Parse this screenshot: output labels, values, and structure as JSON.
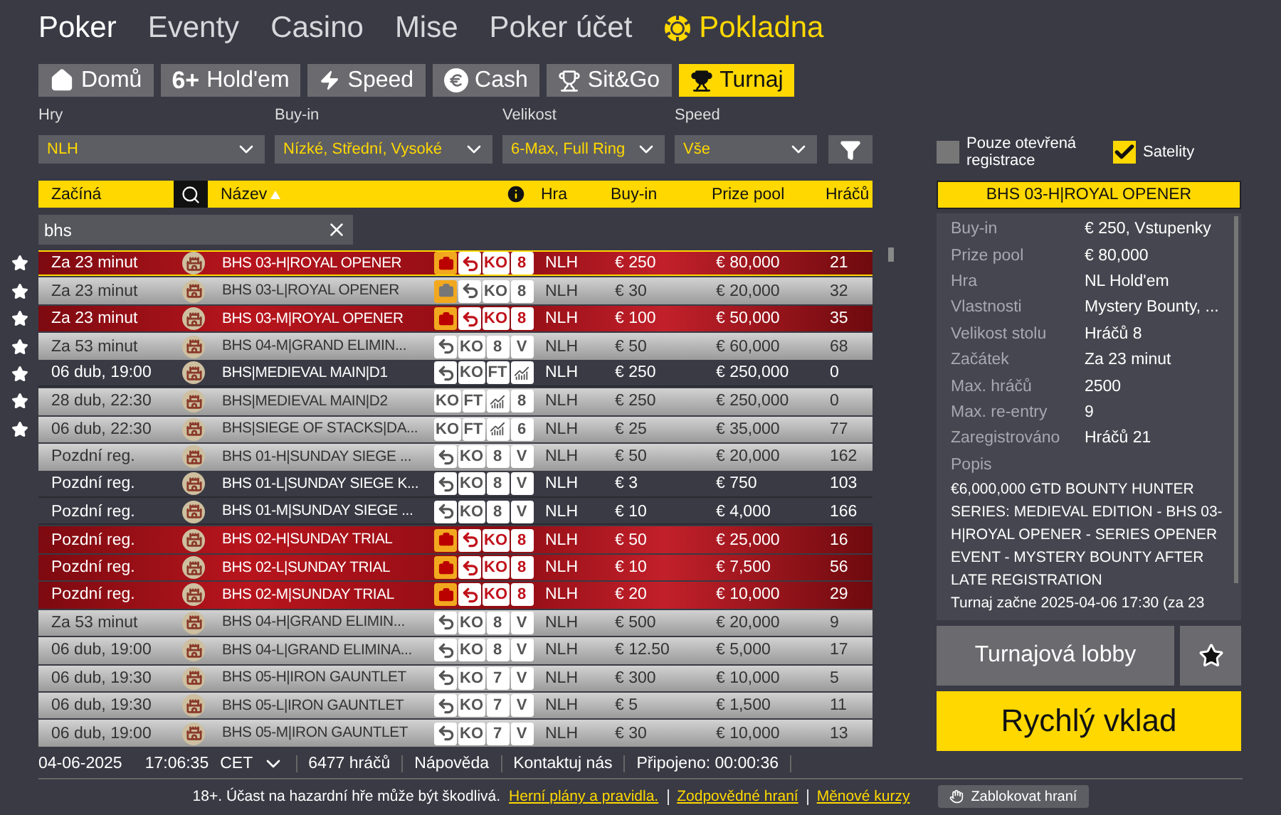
{
  "nav": [
    {
      "label": "Poker",
      "selected": true,
      "kind": "text"
    },
    {
      "label": "Eventy",
      "selected": false,
      "kind": "text"
    },
    {
      "label": "Casino",
      "selected": false,
      "kind": "text"
    },
    {
      "label": "Mise",
      "selected": false,
      "kind": "text"
    },
    {
      "label": "Poker účet",
      "selected": false,
      "kind": "text"
    },
    {
      "label": "Pokladna",
      "selected": false,
      "kind": "cashier"
    }
  ],
  "tabs": [
    {
      "label": "Domů",
      "kind": "home",
      "selected": false
    },
    {
      "label": "Hold'em",
      "kind": "text",
      "icon_text": "6+",
      "selected": false
    },
    {
      "label": "Speed",
      "kind": "bolt",
      "selected": false
    },
    {
      "label": "Cash",
      "kind": "euro",
      "selected": false
    },
    {
      "label": "Sit&Go",
      "kind": "trophy",
      "selected": false
    },
    {
      "label": "Turnaj",
      "kind": "cup",
      "selected": true
    }
  ],
  "filters": [
    {
      "label": "Hry",
      "value": "NLH"
    },
    {
      "label": "Buy-in",
      "value": "Nízké, Střední, Vysoké"
    },
    {
      "label": "Velikost",
      "value": "6-Max, Full Ring"
    },
    {
      "label": "Speed",
      "value": "Vše"
    }
  ],
  "checkboxes": [
    {
      "label": "Pouze otevřená registrace",
      "checked": false
    },
    {
      "label": "Satelity",
      "checked": true
    }
  ],
  "table": {
    "columns": [
      "Začíná",
      "Název",
      "Hra",
      "Buy-in",
      "Prize pool",
      "Hráčů"
    ],
    "search": {
      "value": "bhs"
    },
    "rows": [
      {
        "starts": "Za 23 minut",
        "name": "BHS 03-H|ROYAL OPENER",
        "badges": [
          {
            "kind": "bag"
          },
          {
            "kind": "reentry"
          },
          {
            "kind": "text",
            "text": "KO"
          },
          {
            "kind": "text",
            "text": "8"
          }
        ],
        "game": "NLH",
        "buyin": "€ 250",
        "prize": "€ 80,000",
        "players": "21",
        "kind": "red",
        "selected": true,
        "favorite": true
      },
      {
        "starts": "Za 23 minut",
        "name": "BHS 03-L|ROYAL OPENER",
        "badges": [
          {
            "kind": "bag"
          },
          {
            "kind": "reentry"
          },
          {
            "kind": "text",
            "text": "KO"
          },
          {
            "kind": "text",
            "text": "8"
          }
        ],
        "game": "NLH",
        "buyin": "€ 30",
        "prize": "€ 20,000",
        "players": "32",
        "kind": "grey",
        "selected": false,
        "favorite": true
      },
      {
        "starts": "Za 23 minut",
        "name": "BHS 03-M|ROYAL OPENER",
        "badges": [
          {
            "kind": "bag"
          },
          {
            "kind": "reentry"
          },
          {
            "kind": "text",
            "text": "KO"
          },
          {
            "kind": "text",
            "text": "8"
          }
        ],
        "game": "NLH",
        "buyin": "€ 100",
        "prize": "€ 50,000",
        "players": "35",
        "kind": "red",
        "selected": false,
        "favorite": true
      },
      {
        "starts": "Za 53 minut",
        "name": "BHS 04-M|GRAND ELIMIN...",
        "badges": [
          {
            "kind": "reentry"
          },
          {
            "kind": "text",
            "text": "KO"
          },
          {
            "kind": "text",
            "text": "8"
          },
          {
            "kind": "text",
            "text": "V"
          }
        ],
        "game": "NLH",
        "buyin": "€ 50",
        "prize": "€ 60,000",
        "players": "68",
        "kind": "grey",
        "selected": false,
        "favorite": true
      },
      {
        "starts": "06 dub, 19:00",
        "name": "BHS|MEDIEVAL MAIN|D1",
        "badges": [
          {
            "kind": "reentry"
          },
          {
            "kind": "text",
            "text": "KO"
          },
          {
            "kind": "text",
            "text": "FT"
          },
          {
            "kind": "chart"
          }
        ],
        "game": "NLH",
        "buyin": "€ 250",
        "prize": "€ 250,000",
        "players": "0",
        "kind": "plain",
        "selected": false,
        "favorite": true
      },
      {
        "starts": "28 dub, 22:30",
        "name": "BHS|MEDIEVAL MAIN|D2",
        "badges": [
          {
            "kind": "text",
            "text": "KO"
          },
          {
            "kind": "text",
            "text": "FT"
          },
          {
            "kind": "chart"
          },
          {
            "kind": "text",
            "text": "8"
          }
        ],
        "game": "NLH",
        "buyin": "€ 250",
        "prize": "€ 250,000",
        "players": "0",
        "kind": "grey",
        "selected": false,
        "favorite": true
      },
      {
        "starts": "06 dub, 22:30",
        "name": "BHS|SIEGE OF STACKS|DA...",
        "badges": [
          {
            "kind": "text",
            "text": "KO"
          },
          {
            "kind": "text",
            "text": "FT"
          },
          {
            "kind": "chart"
          },
          {
            "kind": "text",
            "text": "6"
          }
        ],
        "game": "NLH",
        "buyin": "€ 25",
        "prize": "€ 35,000",
        "players": "77",
        "kind": "grey",
        "selected": false,
        "favorite": true
      },
      {
        "starts": "Pozdní reg.",
        "name": "BHS 01-H|SUNDAY SIEGE ...",
        "badges": [
          {
            "kind": "reentry"
          },
          {
            "kind": "text",
            "text": "KO"
          },
          {
            "kind": "text",
            "text": "8"
          },
          {
            "kind": "text",
            "text": "V"
          }
        ],
        "game": "NLH",
        "buyin": "€ 50",
        "prize": "€ 20,000",
        "players": "162",
        "kind": "grey",
        "selected": false,
        "favorite": false
      },
      {
        "starts": "Pozdní reg.",
        "name": "BHS 01-L|SUNDAY SIEGE K...",
        "badges": [
          {
            "kind": "reentry"
          },
          {
            "kind": "text",
            "text": "KO"
          },
          {
            "kind": "text",
            "text": "8"
          },
          {
            "kind": "text",
            "text": "V"
          }
        ],
        "game": "NLH",
        "buyin": "€ 3",
        "prize": "€ 750",
        "players": "103",
        "kind": "plain",
        "selected": false,
        "favorite": false
      },
      {
        "starts": "Pozdní reg.",
        "name": "BHS 01-M|SUNDAY SIEGE ...",
        "badges": [
          {
            "kind": "reentry"
          },
          {
            "kind": "text",
            "text": "KO"
          },
          {
            "kind": "text",
            "text": "8"
          },
          {
            "kind": "text",
            "text": "V"
          }
        ],
        "game": "NLH",
        "buyin": "€ 10",
        "prize": "€ 4,000",
        "players": "166",
        "kind": "plain",
        "selected": false,
        "favorite": false
      },
      {
        "starts": "Pozdní reg.",
        "name": "BHS 02-H|SUNDAY TRIAL",
        "badges": [
          {
            "kind": "bag"
          },
          {
            "kind": "reentry"
          },
          {
            "kind": "text",
            "text": "KO"
          },
          {
            "kind": "text",
            "text": "8"
          }
        ],
        "game": "NLH",
        "buyin": "€ 50",
        "prize": "€ 25,000",
        "players": "16",
        "kind": "red",
        "selected": false,
        "favorite": false
      },
      {
        "starts": "Pozdní reg.",
        "name": "BHS 02-L|SUNDAY TRIAL",
        "badges": [
          {
            "kind": "bag"
          },
          {
            "kind": "reentry"
          },
          {
            "kind": "text",
            "text": "KO"
          },
          {
            "kind": "text",
            "text": "8"
          }
        ],
        "game": "NLH",
        "buyin": "€ 10",
        "prize": "€ 7,500",
        "players": "56",
        "kind": "red",
        "selected": false,
        "favorite": false
      },
      {
        "starts": "Pozdní reg.",
        "name": "BHS 02-M|SUNDAY TRIAL",
        "badges": [
          {
            "kind": "bag"
          },
          {
            "kind": "reentry"
          },
          {
            "kind": "text",
            "text": "KO"
          },
          {
            "kind": "text",
            "text": "8"
          }
        ],
        "game": "NLH",
        "buyin": "€ 20",
        "prize": "€ 10,000",
        "players": "29",
        "kind": "red",
        "selected": false,
        "favorite": false
      },
      {
        "starts": "Za 53 minut",
        "name": "BHS 04-H|GRAND ELIMIN...",
        "badges": [
          {
            "kind": "reentry"
          },
          {
            "kind": "text",
            "text": "KO"
          },
          {
            "kind": "text",
            "text": "8"
          },
          {
            "kind": "text",
            "text": "V"
          }
        ],
        "game": "NLH",
        "buyin": "€ 500",
        "prize": "€ 20,000",
        "players": "9",
        "kind": "grey",
        "selected": false,
        "favorite": false
      },
      {
        "starts": "06 dub, 19:00",
        "name": "BHS 04-L|GRAND ELIMINA...",
        "badges": [
          {
            "kind": "reentry"
          },
          {
            "kind": "text",
            "text": "KO"
          },
          {
            "kind": "text",
            "text": "8"
          },
          {
            "kind": "text",
            "text": "V"
          }
        ],
        "game": "NLH",
        "buyin": "€ 12.50",
        "prize": "€ 5,000",
        "players": "17",
        "kind": "grey",
        "selected": false,
        "favorite": false
      },
      {
        "starts": "06 dub, 19:30",
        "name": "BHS 05-H|IRON GAUNTLET",
        "badges": [
          {
            "kind": "reentry"
          },
          {
            "kind": "text",
            "text": "KO"
          },
          {
            "kind": "text",
            "text": "7"
          },
          {
            "kind": "text",
            "text": "V"
          }
        ],
        "game": "NLH",
        "buyin": "€ 300",
        "prize": "€ 10,000",
        "players": "5",
        "kind": "grey",
        "selected": false,
        "favorite": false
      },
      {
        "starts": "06 dub, 19:30",
        "name": "BHS 05-L|IRON GAUNTLET",
        "badges": [
          {
            "kind": "reentry"
          },
          {
            "kind": "text",
            "text": "KO"
          },
          {
            "kind": "text",
            "text": "7"
          },
          {
            "kind": "text",
            "text": "V"
          }
        ],
        "game": "NLH",
        "buyin": "€ 5",
        "prize": "€ 1,500",
        "players": "11",
        "kind": "grey",
        "selected": false,
        "favorite": false
      },
      {
        "starts": "06 dub, 19:00",
        "name": "BHS 05-M|IRON GAUNTLET",
        "badges": [
          {
            "kind": "reentry"
          },
          {
            "kind": "text",
            "text": "KO"
          },
          {
            "kind": "text",
            "text": "7"
          },
          {
            "kind": "text",
            "text": "V"
          }
        ],
        "game": "NLH",
        "buyin": "€ 30",
        "prize": "€ 10,000",
        "players": "13",
        "kind": "grey",
        "selected": false,
        "favorite": false
      }
    ]
  },
  "details": {
    "title": "BHS 03-H|ROYAL OPENER",
    "fields": [
      {
        "label": "Buy-in",
        "value": "€ 250, Vstupenky"
      },
      {
        "label": "Prize pool",
        "value": "€ 80,000"
      },
      {
        "label": "Hra",
        "value": "NL Hold'em"
      },
      {
        "label": "Vlastnosti",
        "value": "Mystery Bounty, ..."
      },
      {
        "label": "Velikost stolu",
        "value": "Hráčů 8"
      },
      {
        "label": "Začátek",
        "value": "Za 23 minut"
      },
      {
        "label": "Max. hráčů",
        "value": "2500"
      },
      {
        "label": "Max. re-entry",
        "value": "9"
      },
      {
        "label": "Zaregistrováno",
        "value": "Hráčů 21"
      }
    ],
    "description_label": "Popis",
    "description": "€6,000,000 GTD BOUNTY HUNTER SERIES: MEDIEVAL EDITION - BHS 03-H|ROYAL OPENER - SERIES OPENER EVENT - MYSTERY BOUNTY AFTER LATE REGISTRATION",
    "description_more": "Turnaj začne 2025-04-06 17:30 (za 23",
    "lobby_button": "Turnajová lobby",
    "deposit_button": "Rychlý vklad"
  },
  "status_bar": {
    "date": "04-06-2025",
    "time": "17:06:35",
    "timezone": "CET",
    "players": "6477 hráčů",
    "help": "Nápověda",
    "contact": "Kontaktuj nás",
    "connected": "Připojeno: 00:00:36"
  },
  "footer": {
    "warning": "18+. Účast na hazardní hře může být škodlivá.",
    "links": [
      "Herní plány a pravidla.",
      "Zodpovědné hraní",
      "Měnové kurzy"
    ],
    "block_button": "Zablokovat hraní"
  }
}
